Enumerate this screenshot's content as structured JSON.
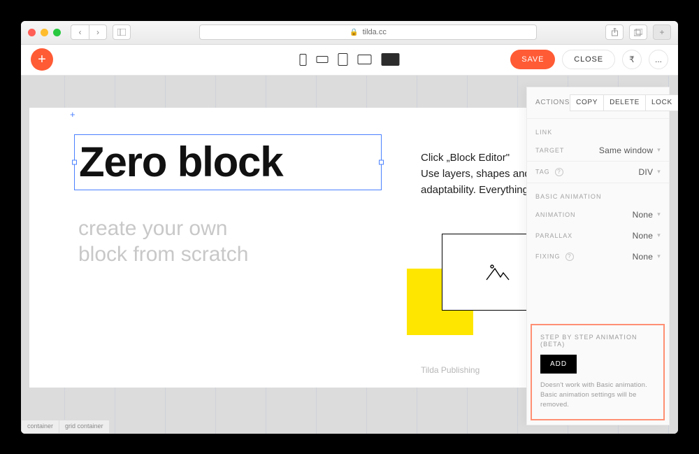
{
  "browser": {
    "url": "tilda.cc"
  },
  "toolbar": {
    "save_label": "SAVE",
    "close_label": "CLOSE",
    "more_label": "...",
    "rupee_label": "₹"
  },
  "canvas": {
    "heading": "Zero block",
    "subtitle_l1": "create your own",
    "subtitle_l2": "block from scratch",
    "body_l1": "Click „Block Editor\"",
    "body_l2": "Use layers, shapes and customize",
    "body_l3": "adaptability. Everything",
    "credit": "Tilda Publishing"
  },
  "panel": {
    "actions_label": "ACTIONS",
    "copy_label": "Copy",
    "delete_label": "Delete",
    "lock_label": "Lock",
    "link_label": "LINK",
    "target_label": "TARGET",
    "target_value": "Same window",
    "tag_label": "TAG",
    "tag_value": "DIV",
    "basic_anim_title": "BASIC ANIMATION",
    "animation_label": "ANIMATION",
    "animation_value": "None",
    "parallax_label": "PARALLAX",
    "parallax_value": "None",
    "fixing_label": "FIXING",
    "fixing_value": "None",
    "step_title": "STEP BY STEP ANIMATION (BETA)",
    "add_label": "ADD",
    "step_note": "Doesn't work with Basic animation. Basic animation settings will be removed."
  },
  "crumbs": {
    "a": "container",
    "b": "grid container"
  }
}
